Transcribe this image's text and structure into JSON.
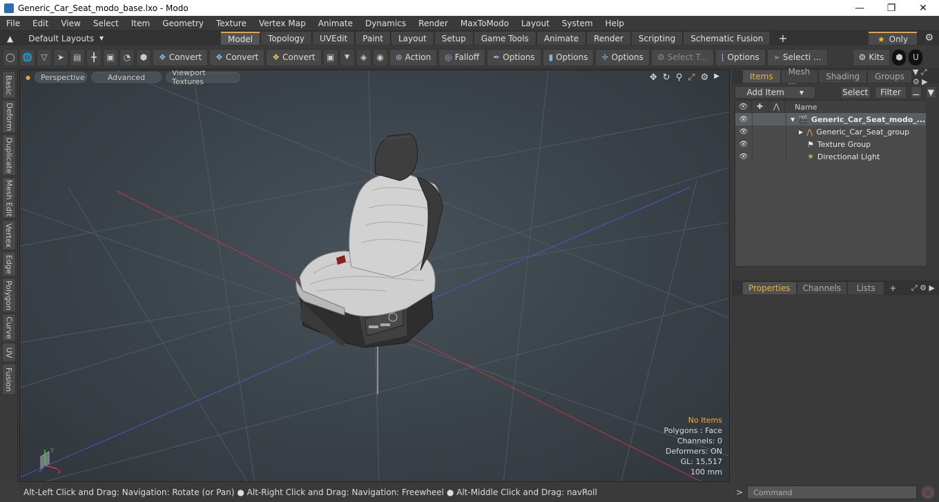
{
  "window": {
    "title": "Generic_Car_Seat_modo_base.lxo - Modo"
  },
  "menu": [
    "File",
    "Edit",
    "View",
    "Select",
    "Item",
    "Geometry",
    "Texture",
    "Vertex Map",
    "Animate",
    "Dynamics",
    "Render",
    "MaxToModo",
    "Layout",
    "System",
    "Help"
  ],
  "layouts": {
    "label": "Default Layouts"
  },
  "tabs": [
    "Model",
    "Topology",
    "UVEdit",
    "Paint",
    "Layout",
    "Setup",
    "Game Tools",
    "Animate",
    "Render",
    "Scripting",
    "Schematic Fusion"
  ],
  "active_tab": "Model",
  "only_label": "Only",
  "toolbar": {
    "convert1": "Convert",
    "convert2": "Convert",
    "convert3": "Convert",
    "action": "Action",
    "falloff": "Falloff",
    "options1": "Options",
    "options2": "Options",
    "options3": "Options",
    "select_t": "Select T...",
    "options4": "Options",
    "selecti": "Selecti ...",
    "kits": "Kits"
  },
  "left_tabs": [
    "Basic",
    "Deform",
    "Duplicate",
    "Mesh Edit",
    "Vertex",
    "Edge",
    "Polygon",
    "Curve",
    "UV",
    "Fusion"
  ],
  "viewport": {
    "perspective": "Perspective",
    "advanced": "Advanced",
    "viewport_textures": "Viewport Textures",
    "info": {
      "no_items": "No Items",
      "polygons": "Polygons : Face",
      "channels": "Channels: 0",
      "deformers": "Deformers: ON",
      "gl": "GL: 15,517",
      "scale": "100 mm"
    }
  },
  "status": "Alt-Left Click and Drag: Navigation: Rotate (or Pan) ● Alt-Right Click and Drag: Navigation: Freewheel ● Alt-Middle Click and Drag: navRoll",
  "items_panel": {
    "tabs": [
      "Items",
      "Mesh ...",
      "Shading",
      "Groups"
    ],
    "add_item": "Add Item",
    "select": "Select",
    "filter": "Filter",
    "name_header": "Name",
    "rows": [
      {
        "label": "Generic_Car_Seat_modo_...",
        "icon": "scene-icon"
      },
      {
        "label": "Generic_Car_Seat_group",
        "icon": "group-locator-icon"
      },
      {
        "label": "Texture Group",
        "icon": "texture-group-icon"
      },
      {
        "label": "Directional Light",
        "icon": "light-icon"
      }
    ]
  },
  "properties_panel": {
    "tabs": [
      "Properties",
      "Channels",
      "Lists"
    ]
  },
  "command": {
    "placeholder": "Command"
  }
}
